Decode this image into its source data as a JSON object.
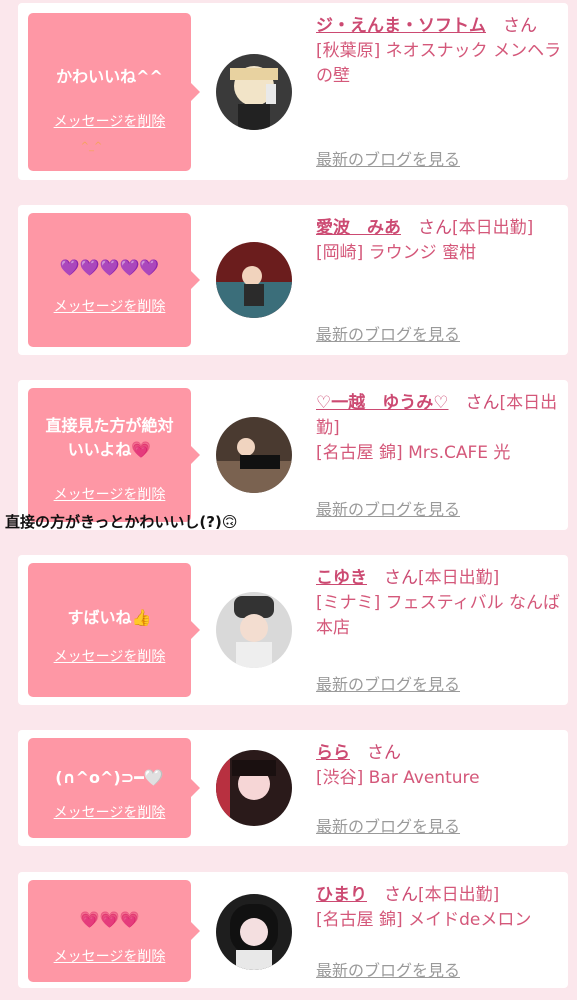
{
  "delete_label": "メッセージを削除",
  "blog_label": "最新のブログを見る",
  "san_suffix": "さん",
  "overlay_text": "直接の方がきっとかわいいし(?)🙃",
  "cards": [
    {
      "message": "かわいいね^^",
      "extra_note": "^_^",
      "name": "ジ・えんま・ソフトム",
      "status": "",
      "shop": "[秋葉原] ネオスナック メンヘラの壁"
    },
    {
      "message": "💜💜💜💜💜",
      "name": "愛波　みあ",
      "status": "[本日出勤]",
      "shop": "[岡崎] ラウンジ 蜜柑"
    },
    {
      "message_line1": "直接見た方が絶対",
      "message_line2": "いいよね💗",
      "name": "♡一越　ゆうみ♡",
      "status": "[本日出勤]",
      "shop": "[名古屋 錦] Mrs.CAFE 光"
    },
    {
      "message": "すばいね👍",
      "name": "こゆき",
      "status": "[本日出勤]",
      "shop": "[ミナミ] フェスティバル なんば本店"
    },
    {
      "message": "(∩^o^)⊃━🤍",
      "name": "らら",
      "status": "",
      "shop": "[渋谷] Bar Aventure"
    },
    {
      "message": "💗💗💗",
      "name": "ひまり",
      "status": "[本日出勤]",
      "shop": "[名古屋 錦] メイドdeメロン"
    }
  ],
  "colors": {
    "background": "#fbe7ec",
    "bubble": "#fe97a5",
    "name": "#cc4a72",
    "link": "#9a9a9a"
  }
}
